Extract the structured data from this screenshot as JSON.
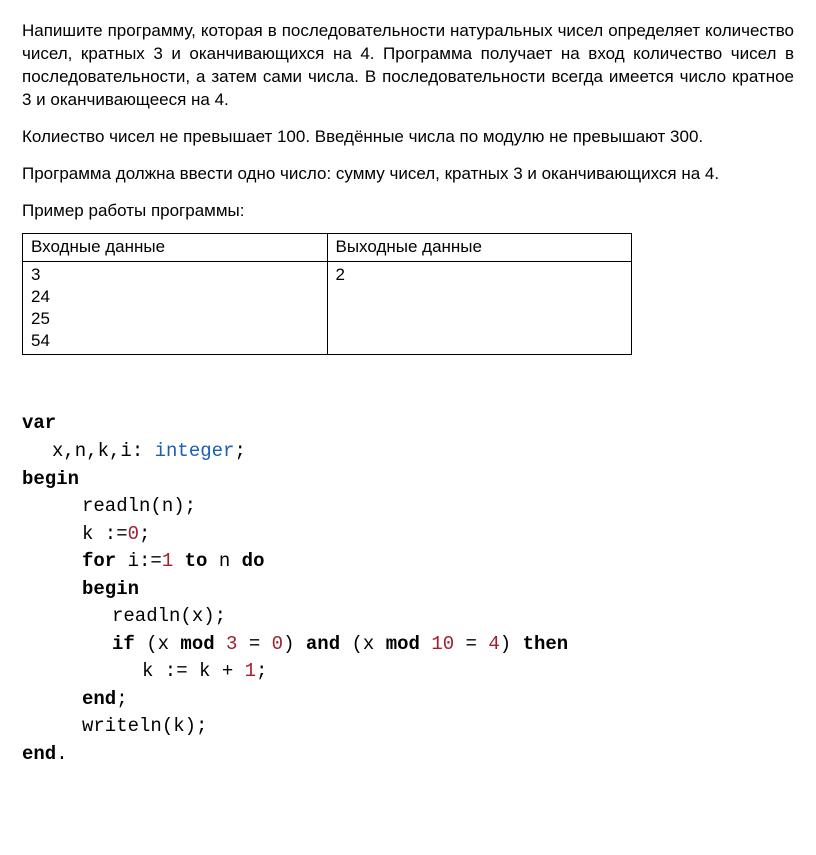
{
  "paragraphs": {
    "p1": "Напишите программу, которая в последовательности натуральных чисел определяет количество чисел, кратных 3 и оканчивающихся на 4. Программа получает на вход количество чисел в последовательности, а затем сами числа. В последовательности всегда имеется число кратное 3 и оканчивающееся на 4.",
    "p2": "Колиество чисел не превышает 100. Введённые числа по модулю не превышают 300.",
    "p3": "Программа должна ввести одно число: сумму чисел, кратных 3 и оканчивающихся на 4.",
    "example_label": "Пример работы программы:"
  },
  "table": {
    "header_in": "Входные данные",
    "header_out": "Выходные данные",
    "input": "3\n24\n25\n54",
    "output": "2"
  },
  "code": {
    "kw_var": "var",
    "decl_vars": "x,n,k,i: ",
    "type_integer": "integer",
    "semi": ";",
    "kw_begin": "begin",
    "readln_n": "readln(n);",
    "k_assign_pre": "k :=",
    "zero": "0",
    "kw_for": "for",
    "for_i": " i:=",
    "one": "1",
    "kw_to": "to",
    "for_n": " n ",
    "kw_do": "do",
    "readln_x": "readln(x);",
    "kw_if": "if",
    "if_open": " (x ",
    "kw_mod": "mod",
    "sp": " ",
    "three": "3",
    "eq0": " = ",
    "rparen": ") ",
    "kw_and": "and",
    "open2": " (x ",
    "ten": "10",
    "eq2": " = ",
    "four": "4",
    "rparen2": ") ",
    "kw_then": "then",
    "k_inc": "k := k + ",
    "kw_end": "end",
    "end_semi": ";",
    "writeln": "writeln(k);",
    "kw_end_dot": "end",
    "dot": "."
  }
}
